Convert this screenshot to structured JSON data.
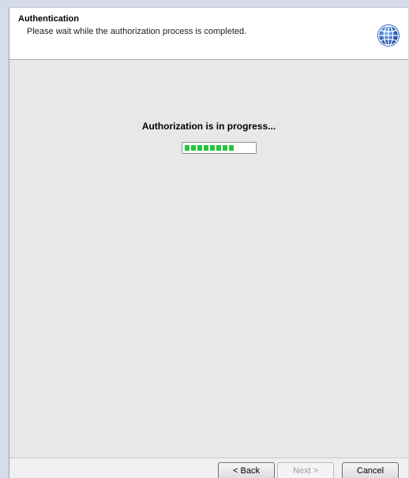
{
  "header": {
    "title": "Authentication",
    "subtitle": "Please wait while the authorization process is completed.",
    "icon": "globe-icon"
  },
  "main": {
    "status_text": "Authorization is in progress...",
    "progress_fraction": 0.72,
    "progress_color": "#25c53c"
  },
  "footer": {
    "back_label": "< Back",
    "next_label": "Next >",
    "cancel_label": "Cancel"
  }
}
